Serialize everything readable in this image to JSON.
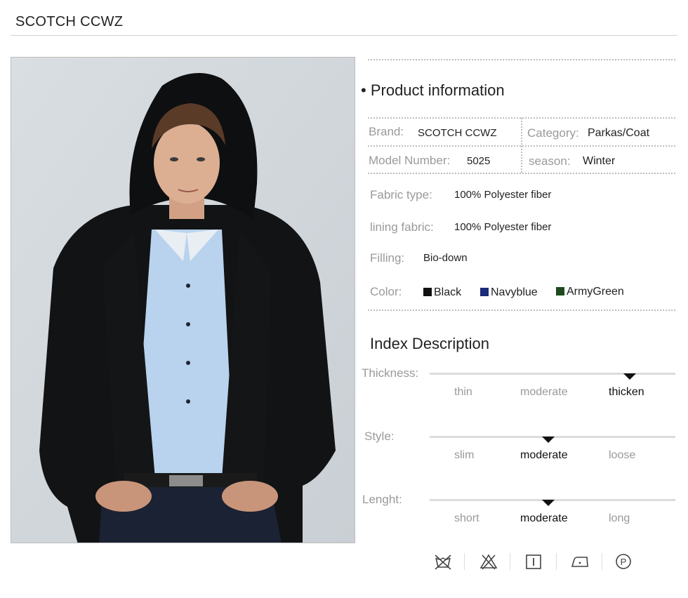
{
  "brand_title": "SCOTCH CCWZ",
  "product_info": {
    "heading": "Product information",
    "bullet": "•",
    "brand_label": "Brand:",
    "brand_value": "SCOTCH CCWZ",
    "category_label": "Category:",
    "category_value": "Parkas/Coat",
    "model_label": "Model Number:",
    "model_value": "5025",
    "season_label": "season:",
    "season_value": "Winter",
    "fabric_label": "Fabric type:",
    "fabric_value": "100% Polyester fiber",
    "lining_label": "lining fabric:",
    "lining_value": "100% Polyester fiber",
    "filling_label": "Filling:",
    "filling_value": "Bio-down",
    "color_label": "Color:",
    "colors": [
      {
        "name": "Black",
        "hex": "#111111"
      },
      {
        "name": "Navyblue",
        "hex": "#1b2a7a"
      },
      {
        "name": "ArmyGreen",
        "hex": "#1f4a1f"
      }
    ]
  },
  "index": {
    "heading": "Index Description",
    "rows": [
      {
        "label": "Thickness:",
        "options": [
          "thin",
          "moderate",
          "thicken"
        ],
        "selected": 2
      },
      {
        "label": "Style:",
        "options": [
          "slim",
          "moderate",
          "loose"
        ],
        "selected": 1
      },
      {
        "label": "Lenght:",
        "options": [
          "short",
          "moderate",
          "long"
        ],
        "selected": 1
      }
    ]
  },
  "care_icons": [
    "no-wash-icon",
    "no-bleach-icon",
    "hang-dry-icon",
    "iron-low-icon",
    "dry-clean-p-icon"
  ]
}
